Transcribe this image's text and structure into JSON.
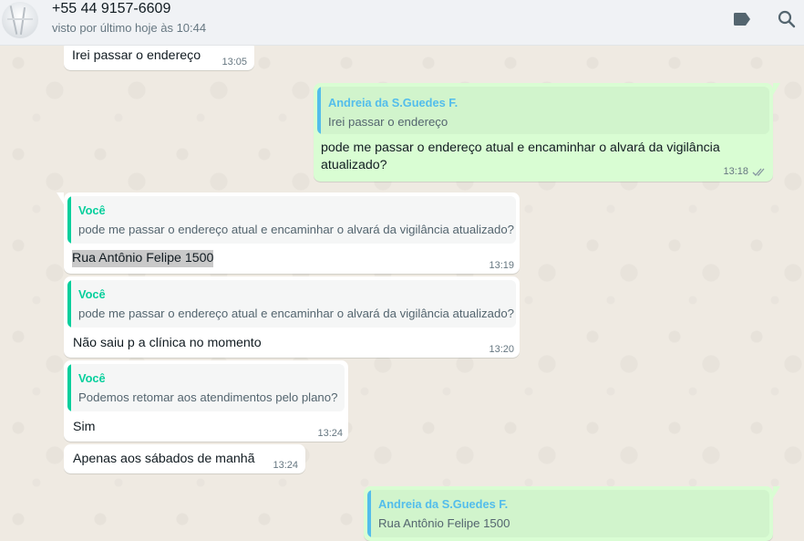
{
  "header": {
    "contact_name": "+55 44 9157-6609",
    "status": "visto por último hoje às 10:44"
  },
  "colors": {
    "header_bg": "#f0f2f5",
    "incoming_bg": "#ffffff",
    "outgoing_bg": "#d9fdd3",
    "quote_author_blue": "#53bdeb",
    "quote_author_green": "#06cf9c",
    "time": "#667781"
  },
  "messages": [
    {
      "direction": "in",
      "text": "Irei passar o endereço",
      "time": "13:05"
    },
    {
      "direction": "out",
      "quote_author": "Andreia da S.Guedes F.",
      "quote_text": "Irei passar o endereço",
      "text_line1": "pode me passar o endereço atual e encaminhar o alvará da vigilância",
      "text_line2": "atualizado?",
      "time": "13:18"
    },
    {
      "direction": "in",
      "quote_author": "Você",
      "quote_text": "pode me passar o endereço atual e encaminhar o alvará da vigilância atualizado?",
      "text": "Rua Antônio Felipe 1500",
      "time": "13:19"
    },
    {
      "direction": "in",
      "quote_author": "Você",
      "quote_text": "pode me passar o endereço atual e encaminhar o alvará da vigilância atualizado?",
      "text": "Não saiu p a clínica no momento",
      "time": "13:20"
    },
    {
      "direction": "in",
      "quote_author": "Você",
      "quote_text": "Podemos retomar aos atendimentos pelo plano?",
      "text": "Sim",
      "time": "13:24"
    },
    {
      "direction": "in",
      "text": "Apenas aos sábados de manhã",
      "time": "13:24"
    },
    {
      "direction": "out",
      "quote_author": "Andreia da S.Guedes F.",
      "quote_text": "Rua Antônio Felipe 1500"
    }
  ]
}
